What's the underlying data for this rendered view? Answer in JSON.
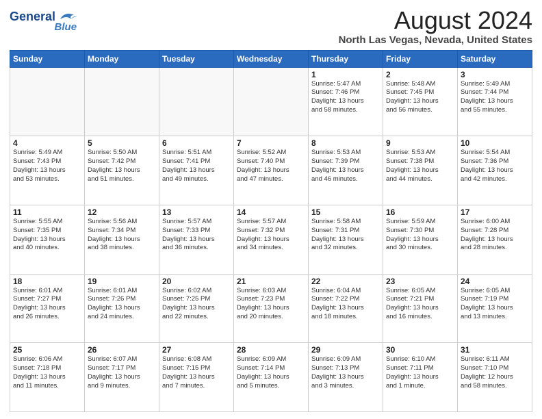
{
  "header": {
    "logo_line1": "General",
    "logo_line2": "Blue",
    "title": "August 2024",
    "subtitle": "North Las Vegas, Nevada, United States"
  },
  "weekdays": [
    "Sunday",
    "Monday",
    "Tuesday",
    "Wednesday",
    "Thursday",
    "Friday",
    "Saturday"
  ],
  "weeks": [
    [
      {
        "day": "",
        "info": ""
      },
      {
        "day": "",
        "info": ""
      },
      {
        "day": "",
        "info": ""
      },
      {
        "day": "",
        "info": ""
      },
      {
        "day": "1",
        "info": "Sunrise: 5:47 AM\nSunset: 7:46 PM\nDaylight: 13 hours\nand 58 minutes."
      },
      {
        "day": "2",
        "info": "Sunrise: 5:48 AM\nSunset: 7:45 PM\nDaylight: 13 hours\nand 56 minutes."
      },
      {
        "day": "3",
        "info": "Sunrise: 5:49 AM\nSunset: 7:44 PM\nDaylight: 13 hours\nand 55 minutes."
      }
    ],
    [
      {
        "day": "4",
        "info": "Sunrise: 5:49 AM\nSunset: 7:43 PM\nDaylight: 13 hours\nand 53 minutes."
      },
      {
        "day": "5",
        "info": "Sunrise: 5:50 AM\nSunset: 7:42 PM\nDaylight: 13 hours\nand 51 minutes."
      },
      {
        "day": "6",
        "info": "Sunrise: 5:51 AM\nSunset: 7:41 PM\nDaylight: 13 hours\nand 49 minutes."
      },
      {
        "day": "7",
        "info": "Sunrise: 5:52 AM\nSunset: 7:40 PM\nDaylight: 13 hours\nand 47 minutes."
      },
      {
        "day": "8",
        "info": "Sunrise: 5:53 AM\nSunset: 7:39 PM\nDaylight: 13 hours\nand 46 minutes."
      },
      {
        "day": "9",
        "info": "Sunrise: 5:53 AM\nSunset: 7:38 PM\nDaylight: 13 hours\nand 44 minutes."
      },
      {
        "day": "10",
        "info": "Sunrise: 5:54 AM\nSunset: 7:36 PM\nDaylight: 13 hours\nand 42 minutes."
      }
    ],
    [
      {
        "day": "11",
        "info": "Sunrise: 5:55 AM\nSunset: 7:35 PM\nDaylight: 13 hours\nand 40 minutes."
      },
      {
        "day": "12",
        "info": "Sunrise: 5:56 AM\nSunset: 7:34 PM\nDaylight: 13 hours\nand 38 minutes."
      },
      {
        "day": "13",
        "info": "Sunrise: 5:57 AM\nSunset: 7:33 PM\nDaylight: 13 hours\nand 36 minutes."
      },
      {
        "day": "14",
        "info": "Sunrise: 5:57 AM\nSunset: 7:32 PM\nDaylight: 13 hours\nand 34 minutes."
      },
      {
        "day": "15",
        "info": "Sunrise: 5:58 AM\nSunset: 7:31 PM\nDaylight: 13 hours\nand 32 minutes."
      },
      {
        "day": "16",
        "info": "Sunrise: 5:59 AM\nSunset: 7:30 PM\nDaylight: 13 hours\nand 30 minutes."
      },
      {
        "day": "17",
        "info": "Sunrise: 6:00 AM\nSunset: 7:28 PM\nDaylight: 13 hours\nand 28 minutes."
      }
    ],
    [
      {
        "day": "18",
        "info": "Sunrise: 6:01 AM\nSunset: 7:27 PM\nDaylight: 13 hours\nand 26 minutes."
      },
      {
        "day": "19",
        "info": "Sunrise: 6:01 AM\nSunset: 7:26 PM\nDaylight: 13 hours\nand 24 minutes."
      },
      {
        "day": "20",
        "info": "Sunrise: 6:02 AM\nSunset: 7:25 PM\nDaylight: 13 hours\nand 22 minutes."
      },
      {
        "day": "21",
        "info": "Sunrise: 6:03 AM\nSunset: 7:23 PM\nDaylight: 13 hours\nand 20 minutes."
      },
      {
        "day": "22",
        "info": "Sunrise: 6:04 AM\nSunset: 7:22 PM\nDaylight: 13 hours\nand 18 minutes."
      },
      {
        "day": "23",
        "info": "Sunrise: 6:05 AM\nSunset: 7:21 PM\nDaylight: 13 hours\nand 16 minutes."
      },
      {
        "day": "24",
        "info": "Sunrise: 6:05 AM\nSunset: 7:19 PM\nDaylight: 13 hours\nand 13 minutes."
      }
    ],
    [
      {
        "day": "25",
        "info": "Sunrise: 6:06 AM\nSunset: 7:18 PM\nDaylight: 13 hours\nand 11 minutes."
      },
      {
        "day": "26",
        "info": "Sunrise: 6:07 AM\nSunset: 7:17 PM\nDaylight: 13 hours\nand 9 minutes."
      },
      {
        "day": "27",
        "info": "Sunrise: 6:08 AM\nSunset: 7:15 PM\nDaylight: 13 hours\nand 7 minutes."
      },
      {
        "day": "28",
        "info": "Sunrise: 6:09 AM\nSunset: 7:14 PM\nDaylight: 13 hours\nand 5 minutes."
      },
      {
        "day": "29",
        "info": "Sunrise: 6:09 AM\nSunset: 7:13 PM\nDaylight: 13 hours\nand 3 minutes."
      },
      {
        "day": "30",
        "info": "Sunrise: 6:10 AM\nSunset: 7:11 PM\nDaylight: 13 hours\nand 1 minute."
      },
      {
        "day": "31",
        "info": "Sunrise: 6:11 AM\nSunset: 7:10 PM\nDaylight: 12 hours\nand 58 minutes."
      }
    ]
  ]
}
